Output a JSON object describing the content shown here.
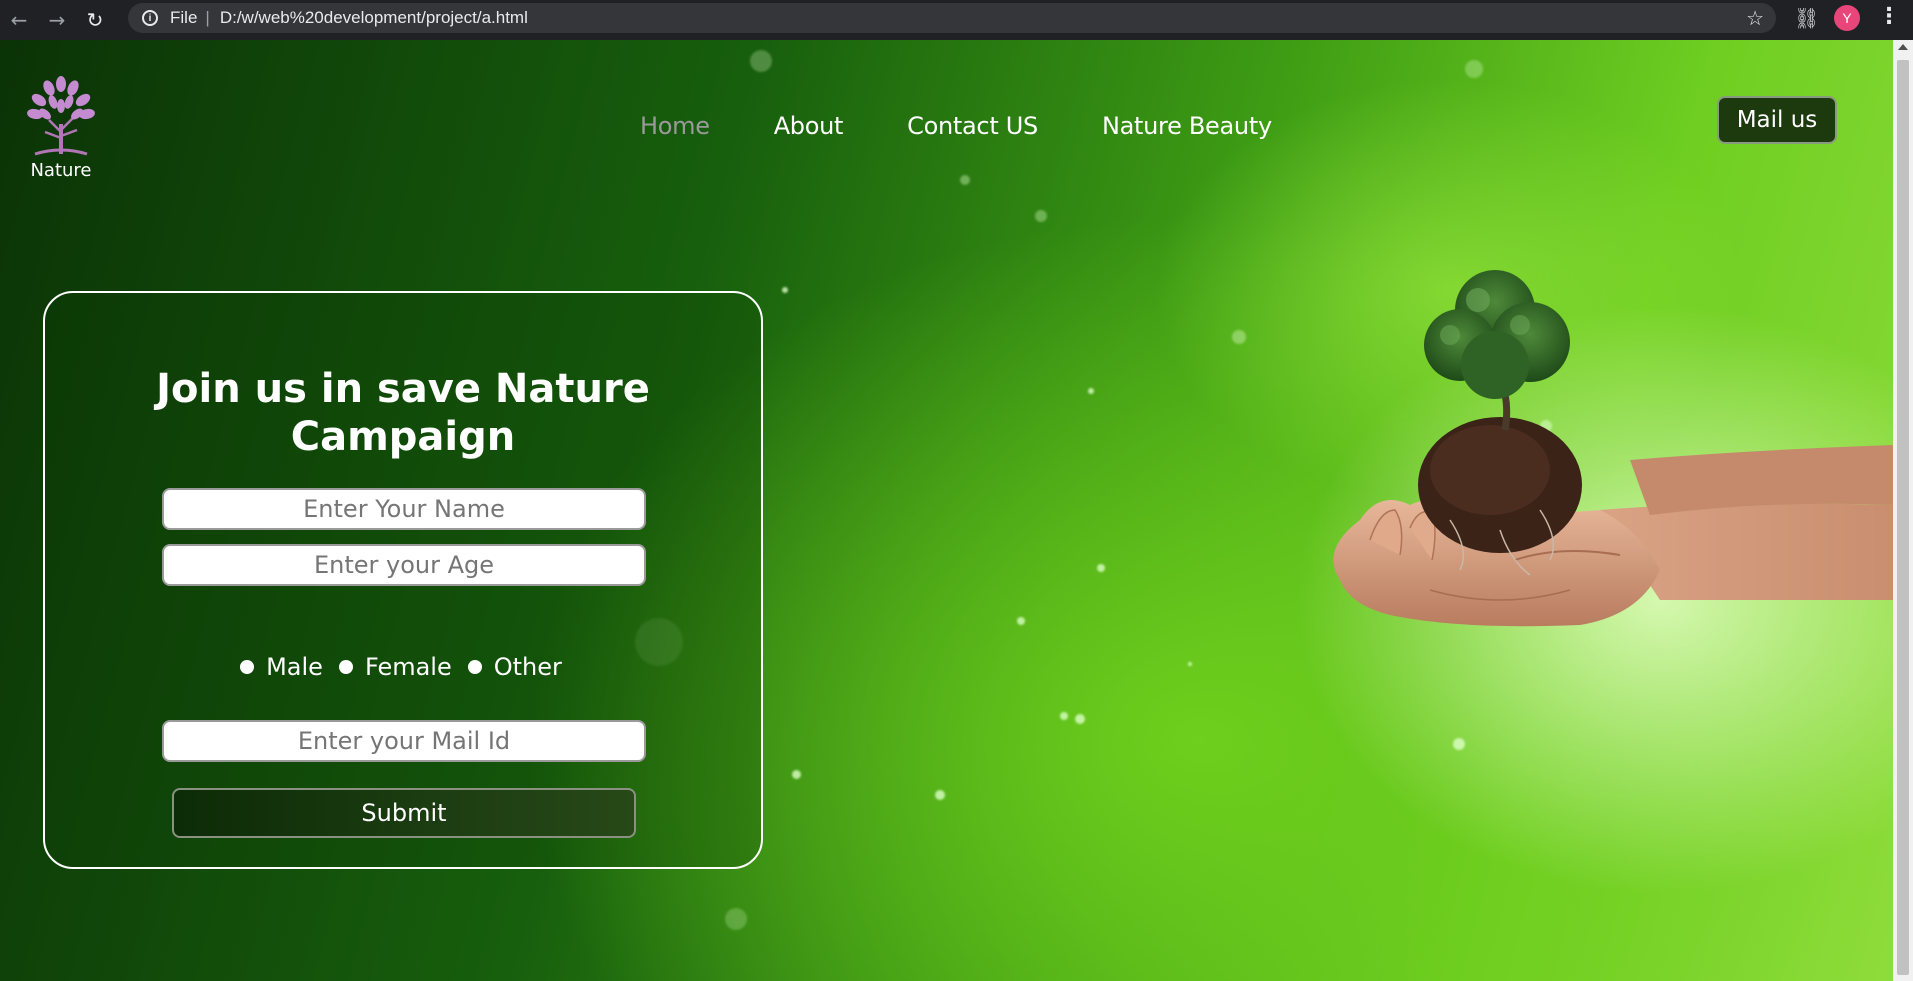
{
  "browser": {
    "protocol_label": "File",
    "url": "D:/w/web%20development/project/a.html",
    "profile_initial": "Y"
  },
  "logo": {
    "text": "Nature"
  },
  "nav": {
    "items": [
      {
        "label": "Home",
        "current": true
      },
      {
        "label": "About"
      },
      {
        "label": "Contact US"
      },
      {
        "label": "Nature Beauty"
      }
    ]
  },
  "mail_button": "Mail us",
  "form": {
    "title": "Join us in save Nature Campaign",
    "name_placeholder": "Enter Your Name",
    "age_placeholder": "Enter your Age",
    "gender_options": [
      "Male",
      "Female",
      "Other"
    ],
    "mail_placeholder": "Enter your Mail Id",
    "submit_label": "Submit"
  },
  "colors": {
    "nav_current": "#9a9a9a",
    "nav_text": "#ffffff",
    "mail_button_bg": "#1d3a0f",
    "profile_avatar": "#e8457a"
  }
}
